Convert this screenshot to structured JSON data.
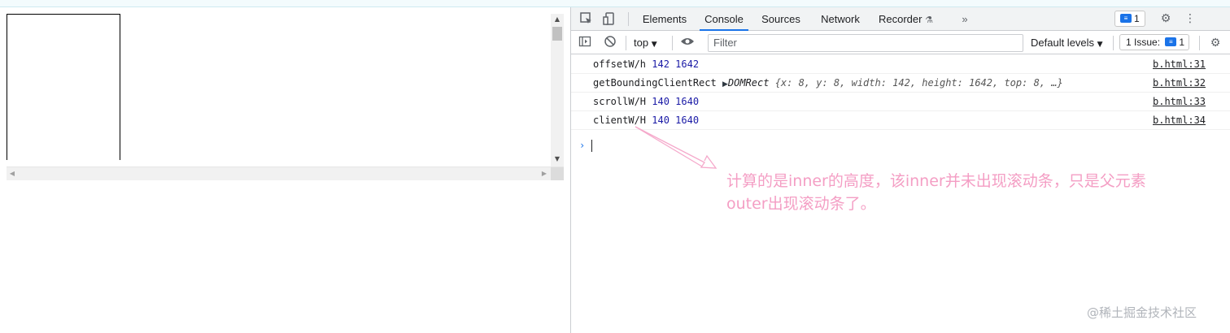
{
  "devtools": {
    "tabs": [
      {
        "label": "Elements",
        "active": false
      },
      {
        "label": "Console",
        "active": true
      },
      {
        "label": "Sources",
        "active": false
      },
      {
        "label": "Network",
        "active": false
      },
      {
        "label": "Recorder",
        "active": false
      }
    ],
    "more_tabs": "»",
    "recorder_icon": "flask-icon",
    "messages_badge": "1",
    "toolbar": {
      "context": "top",
      "filter_placeholder": "Filter",
      "levels": "Default levels",
      "issues": "1 Issue:",
      "issues_count": "1"
    },
    "console": {
      "rows": [
        {
          "label": "offsetW/h",
          "value": "142 1642",
          "source": "b.html:31"
        },
        {
          "label": "getBoundingClientRect",
          "object": "DOMRect",
          "preview": "{x: 8, y: 8, width: 142, height: 1642, top: 8, …}",
          "source": "b.html:32"
        },
        {
          "label": "scrollW/H",
          "value": "140 1640",
          "source": "b.html:33"
        },
        {
          "label": "clientW/H",
          "value": "140 1640",
          "source": "b.html:34"
        }
      ],
      "prompt": "›"
    }
  },
  "annotation": {
    "line1": "计算的是inner的高度，该inner并未出现滚动条，只是父元素",
    "line2": "outer出现滚动条了。",
    "color": "#f49ec4"
  },
  "watermark": "@稀土掘金技术社区",
  "colors": {
    "accent": "#1a73e8",
    "number": "#1a1aa6",
    "panel_bg": "#f1f3f4"
  }
}
